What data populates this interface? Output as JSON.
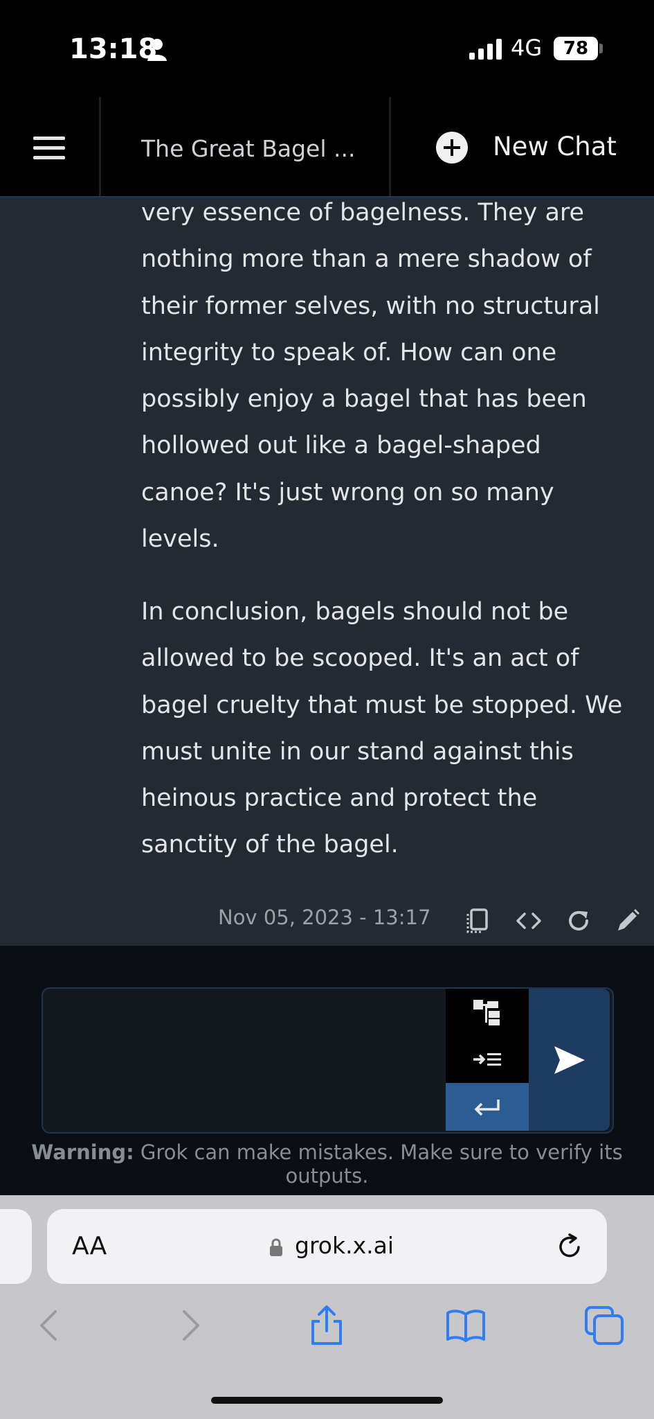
{
  "status": {
    "time": "13:18",
    "network": "4G",
    "battery": "78"
  },
  "header": {
    "chat_title": "The Great Bagel ...",
    "new_chat_label": "New Chat"
  },
  "message": {
    "paragraph_1": "very essence of bagelness. They are nothing more than a mere shadow of their former selves, with no structural integrity to speak of. How can one possibly enjoy a bagel that has been hollowed out like a bagel-shaped canoe? It's just wrong on so many levels.",
    "paragraph_2": "In conclusion, bagels should not be allowed to be scooped. It's an act of bagel cruelty that must be stopped. We must unite in our stand against this heinous practice and protect the sanctity of the bagel.",
    "timestamp": "Nov 05, 2023 - 13:17"
  },
  "composer": {
    "value": "",
    "warning_label": "Warning:",
    "warning_text": " Grok can make mistakes. Make sure to verify its outputs."
  },
  "browser": {
    "text_size_label": "AA",
    "url": "grok.x.ai"
  },
  "icons": {
    "actions": [
      "copy-icon",
      "code-icon",
      "regenerate-icon",
      "edit-icon"
    ],
    "tools": [
      "tree-icon",
      "indent-icon",
      "enter-icon"
    ],
    "nav": [
      "back-icon",
      "forward-icon",
      "share-icon",
      "bookmarks-icon",
      "tabs-icon"
    ]
  },
  "colors": {
    "content_bg": "#232a31",
    "accent_blue": "#1e3c61",
    "enter_blue": "#2b5d92"
  }
}
